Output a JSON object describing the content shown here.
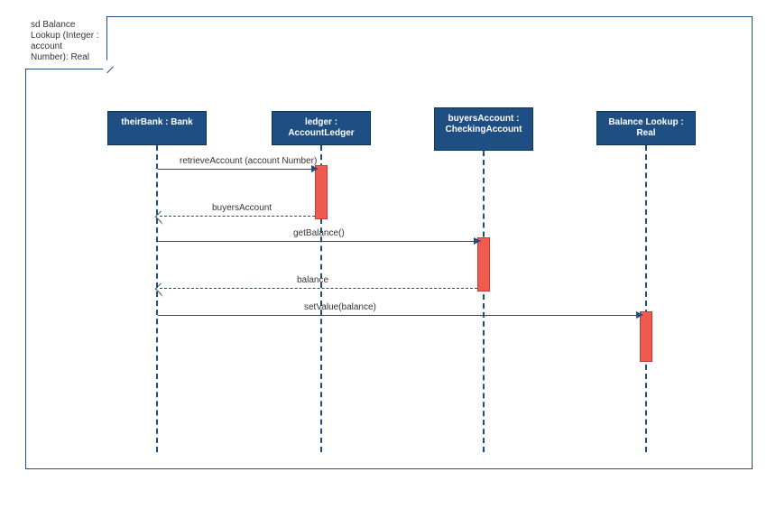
{
  "frame": {
    "label": "sd Balance Lookup (Integer : account Number): Real"
  },
  "lifelines": {
    "l1": "theirBank : Bank",
    "l2": "ledger : AccountLedger",
    "l3": "buyersAccount : CheckingAccount",
    "l4": "Balance Lookup : Real"
  },
  "messages": {
    "m1": "retrieveAccount (account Number)",
    "m2": "buyersAccount",
    "m3": "getBalance()",
    "m4": "balance",
    "m5": "setValue(balance)"
  }
}
